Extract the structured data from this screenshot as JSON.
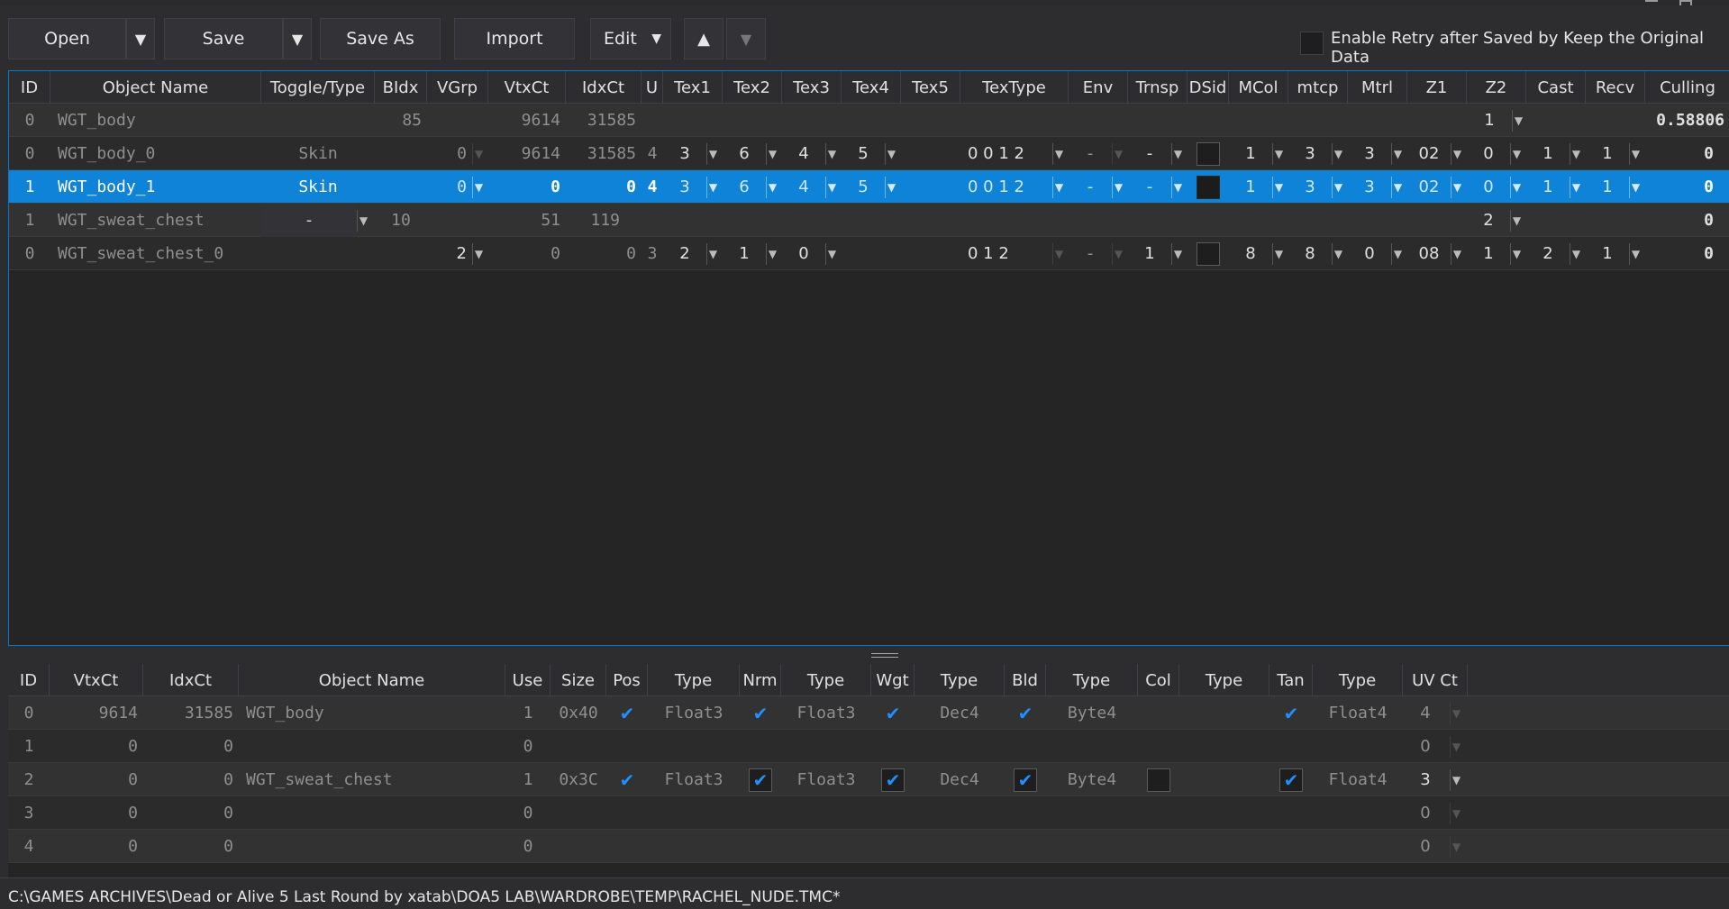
{
  "toolbar": {
    "open_label": "Open",
    "save_label": "Save",
    "save_as_label": "Save As",
    "import_label": "Import",
    "edit_label": "Edit",
    "retry_label": "Enable Retry after Saved by Keep the Original Data"
  },
  "objects_table": {
    "headers": [
      "ID",
      "Object Name",
      "Toggle/Type",
      "BIdx",
      "VGrp",
      "VtxCt",
      "IdxCt",
      "U",
      "Tex1",
      "Tex2",
      "Tex3",
      "Tex4",
      "Tex5",
      "TexType",
      "Env",
      "Trnsp",
      "DSid",
      "MCol",
      "mtcp",
      "Mtrl",
      "Z1",
      "Z2",
      "Cast",
      "Recv",
      "Culling"
    ],
    "rows": [
      {
        "id": "0",
        "name": "WGT_body",
        "type": "",
        "bidx": "85",
        "vgrp": "",
        "vtx": "9614",
        "idx": "31585",
        "u": "",
        "tex1": "",
        "tex2": "",
        "tex3": "",
        "tex4": "",
        "textype": "",
        "env": "",
        "trnsp": "",
        "mcol": "",
        "mtcp": "",
        "mtrl": "",
        "z1": "",
        "z2": "1",
        "cast": "",
        "recv": "",
        "culling": "0.58806"
      },
      {
        "id": "0",
        "name": "WGT_body_0",
        "type": "Skin",
        "bidx": "",
        "vgrp": "0",
        "vtx": "9614",
        "idx": "31585",
        "u": "4",
        "tex1": "3",
        "tex2": "6",
        "tex3": "4",
        "tex4": "5",
        "textype": "0 0 1 2",
        "env": "-",
        "trnsp": "-",
        "mcol": "1",
        "mtcp": "3",
        "mtrl": "3",
        "z1": "02",
        "z2": "0",
        "cast": "1",
        "recv": "1",
        "culling": "0"
      },
      {
        "id": "1",
        "name": "WGT_body_1",
        "type": "Skin",
        "bidx": "",
        "vgrp": "0",
        "vtx": "0",
        "idx": "0",
        "u": "4",
        "tex1": "3",
        "tex2": "6",
        "tex3": "4",
        "tex4": "5",
        "textype": "0 0 1 2",
        "env": "-",
        "trnsp": "-",
        "mcol": "1",
        "mtcp": "3",
        "mtrl": "3",
        "z1": "02",
        "z2": "0",
        "cast": "1",
        "recv": "1",
        "culling": "0"
      },
      {
        "id": "1",
        "name": "WGT_sweat_chest",
        "type": "-",
        "bidx": "10",
        "vgrp": "",
        "vtx": "51",
        "idx": "119",
        "u": "",
        "tex1": "",
        "tex2": "",
        "tex3": "",
        "tex4": "",
        "textype": "",
        "env": "",
        "trnsp": "",
        "mcol": "",
        "mtcp": "",
        "mtrl": "",
        "z1": "",
        "z2": "2",
        "cast": "",
        "recv": "",
        "culling": "0"
      },
      {
        "id": "0",
        "name": "WGT_sweat_chest_0",
        "type": "",
        "bidx": "",
        "vgrp": "2",
        "vtx": "0",
        "idx": "0",
        "u": "3",
        "tex1": "2",
        "tex2": "1",
        "tex3": "0",
        "tex4": "",
        "textype": "0 1 2",
        "env": "-",
        "trnsp": "1",
        "mcol": "8",
        "mtcp": "8",
        "mtrl": "0",
        "z1": "08",
        "z2": "1",
        "cast": "2",
        "recv": "1",
        "culling": "0"
      }
    ]
  },
  "vertex_table": {
    "headers": [
      "ID",
      "VtxCt",
      "IdxCt",
      "Object Name",
      "Use",
      "Size",
      "Pos",
      "Type",
      "Nrm",
      "Type",
      "Wgt",
      "Type",
      "Bld",
      "Type",
      "Col",
      "Type",
      "Tan",
      "Type",
      "UV Ct"
    ],
    "rows": [
      {
        "id": "0",
        "vtx": "9614",
        "idx": "31585",
        "name": "WGT_body",
        "use": "1",
        "size": "0x40",
        "pos_type": "Float3",
        "nrm_type": "Float3",
        "wgt_type": "Dec4",
        "bld_type": "Byte4",
        "tan_type": "Float4",
        "uv": "4"
      },
      {
        "id": "1",
        "vtx": "0",
        "idx": "0",
        "name": "",
        "use": "0",
        "size": "",
        "pos_type": "",
        "nrm_type": "",
        "wgt_type": "",
        "bld_type": "",
        "tan_type": "",
        "uv": "0"
      },
      {
        "id": "2",
        "vtx": "0",
        "idx": "0",
        "name": "WGT_sweat_chest",
        "use": "1",
        "size": "0x3C",
        "pos_type": "Float3",
        "nrm_type": "Float3",
        "wgt_type": "Dec4",
        "bld_type": "Byte4",
        "tan_type": "Float4",
        "uv": "3"
      },
      {
        "id": "3",
        "vtx": "0",
        "idx": "0",
        "name": "",
        "use": "0",
        "size": "",
        "pos_type": "",
        "nrm_type": "",
        "wgt_type": "",
        "bld_type": "",
        "tan_type": "",
        "uv": "0"
      },
      {
        "id": "4",
        "vtx": "0",
        "idx": "0",
        "name": "",
        "use": "0",
        "size": "",
        "pos_type": "",
        "nrm_type": "",
        "wgt_type": "",
        "bld_type": "",
        "tan_type": "",
        "uv": "0"
      }
    ]
  },
  "status": {
    "path": "C:\\GAMES ARCHIVES\\Dead or Alive 5 Last Round by xatab\\DOA5 LAB\\WARDROBE\\TEMP\\RACHEL_NUDE.TMC*"
  },
  "colors": {
    "accent": "#007acc",
    "selection": "#0e83d8",
    "background": "#2d2d30",
    "grid": "#252526"
  }
}
